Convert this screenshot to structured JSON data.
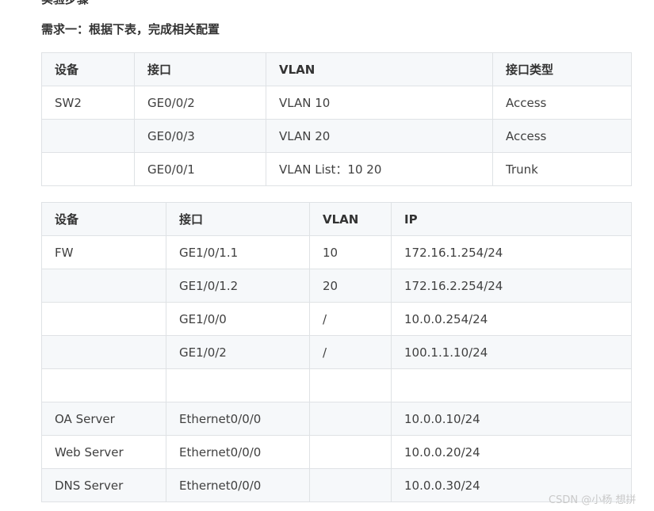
{
  "clipped_heading": "实验步骤",
  "requirement_heading": "需求一：根据下表，完成相关配置",
  "table1": {
    "headers": [
      "设备",
      "接口",
      "VLAN",
      "接口类型"
    ],
    "rows": [
      [
        "SW2",
        "GE0/0/2",
        "VLAN 10",
        "Access"
      ],
      [
        "",
        "GE0/0/3",
        "VLAN 20",
        "Access"
      ],
      [
        "",
        "GE0/0/1",
        "VLAN List：10 20",
        "Trunk"
      ]
    ]
  },
  "table2": {
    "headers": [
      "设备",
      "接口",
      "VLAN",
      "IP"
    ],
    "rows": [
      [
        "FW",
        "GE1/0/1.1",
        "10",
        "172.16.1.254/24"
      ],
      [
        "",
        "GE1/0/1.2",
        "20",
        "172.16.2.254/24"
      ],
      [
        "",
        "GE1/0/0",
        "/",
        "10.0.0.254/24"
      ],
      [
        "",
        "GE1/0/2",
        "/",
        "100.1.1.10/24"
      ],
      [
        "",
        "",
        "",
        ""
      ],
      [
        "OA Server",
        "Ethernet0/0/0",
        "",
        "10.0.0.10/24"
      ],
      [
        "Web Server",
        "Ethernet0/0/0",
        "",
        "10.0.0.20/24"
      ],
      [
        "DNS Server",
        "Ethernet0/0/0",
        "",
        "10.0.0.30/24"
      ]
    ]
  },
  "watermark": "CSDN @小杨 想拼"
}
